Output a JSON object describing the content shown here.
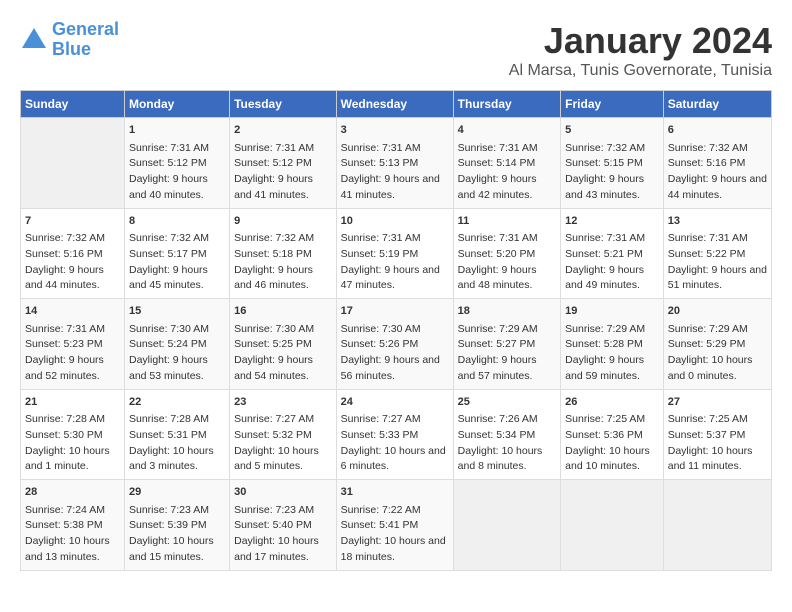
{
  "header": {
    "logo_line1": "General",
    "logo_line2": "Blue",
    "title": "January 2024",
    "subtitle": "Al Marsa, Tunis Governorate, Tunisia"
  },
  "calendar": {
    "days_of_week": [
      "Sunday",
      "Monday",
      "Tuesday",
      "Wednesday",
      "Thursday",
      "Friday",
      "Saturday"
    ],
    "weeks": [
      [
        {
          "day": "",
          "sunrise": "",
          "sunset": "",
          "daylight": ""
        },
        {
          "day": "1",
          "sunrise": "Sunrise: 7:31 AM",
          "sunset": "Sunset: 5:12 PM",
          "daylight": "Daylight: 9 hours and 40 minutes."
        },
        {
          "day": "2",
          "sunrise": "Sunrise: 7:31 AM",
          "sunset": "Sunset: 5:12 PM",
          "daylight": "Daylight: 9 hours and 41 minutes."
        },
        {
          "day": "3",
          "sunrise": "Sunrise: 7:31 AM",
          "sunset": "Sunset: 5:13 PM",
          "daylight": "Daylight: 9 hours and 41 minutes."
        },
        {
          "day": "4",
          "sunrise": "Sunrise: 7:31 AM",
          "sunset": "Sunset: 5:14 PM",
          "daylight": "Daylight: 9 hours and 42 minutes."
        },
        {
          "day": "5",
          "sunrise": "Sunrise: 7:32 AM",
          "sunset": "Sunset: 5:15 PM",
          "daylight": "Daylight: 9 hours and 43 minutes."
        },
        {
          "day": "6",
          "sunrise": "Sunrise: 7:32 AM",
          "sunset": "Sunset: 5:16 PM",
          "daylight": "Daylight: 9 hours and 44 minutes."
        }
      ],
      [
        {
          "day": "7",
          "sunrise": "Sunrise: 7:32 AM",
          "sunset": "Sunset: 5:16 PM",
          "daylight": "Daylight: 9 hours and 44 minutes."
        },
        {
          "day": "8",
          "sunrise": "Sunrise: 7:32 AM",
          "sunset": "Sunset: 5:17 PM",
          "daylight": "Daylight: 9 hours and 45 minutes."
        },
        {
          "day": "9",
          "sunrise": "Sunrise: 7:32 AM",
          "sunset": "Sunset: 5:18 PM",
          "daylight": "Daylight: 9 hours and 46 minutes."
        },
        {
          "day": "10",
          "sunrise": "Sunrise: 7:31 AM",
          "sunset": "Sunset: 5:19 PM",
          "daylight": "Daylight: 9 hours and 47 minutes."
        },
        {
          "day": "11",
          "sunrise": "Sunrise: 7:31 AM",
          "sunset": "Sunset: 5:20 PM",
          "daylight": "Daylight: 9 hours and 48 minutes."
        },
        {
          "day": "12",
          "sunrise": "Sunrise: 7:31 AM",
          "sunset": "Sunset: 5:21 PM",
          "daylight": "Daylight: 9 hours and 49 minutes."
        },
        {
          "day": "13",
          "sunrise": "Sunrise: 7:31 AM",
          "sunset": "Sunset: 5:22 PM",
          "daylight": "Daylight: 9 hours and 51 minutes."
        }
      ],
      [
        {
          "day": "14",
          "sunrise": "Sunrise: 7:31 AM",
          "sunset": "Sunset: 5:23 PM",
          "daylight": "Daylight: 9 hours and 52 minutes."
        },
        {
          "day": "15",
          "sunrise": "Sunrise: 7:30 AM",
          "sunset": "Sunset: 5:24 PM",
          "daylight": "Daylight: 9 hours and 53 minutes."
        },
        {
          "day": "16",
          "sunrise": "Sunrise: 7:30 AM",
          "sunset": "Sunset: 5:25 PM",
          "daylight": "Daylight: 9 hours and 54 minutes."
        },
        {
          "day": "17",
          "sunrise": "Sunrise: 7:30 AM",
          "sunset": "Sunset: 5:26 PM",
          "daylight": "Daylight: 9 hours and 56 minutes."
        },
        {
          "day": "18",
          "sunrise": "Sunrise: 7:29 AM",
          "sunset": "Sunset: 5:27 PM",
          "daylight": "Daylight: 9 hours and 57 minutes."
        },
        {
          "day": "19",
          "sunrise": "Sunrise: 7:29 AM",
          "sunset": "Sunset: 5:28 PM",
          "daylight": "Daylight: 9 hours and 59 minutes."
        },
        {
          "day": "20",
          "sunrise": "Sunrise: 7:29 AM",
          "sunset": "Sunset: 5:29 PM",
          "daylight": "Daylight: 10 hours and 0 minutes."
        }
      ],
      [
        {
          "day": "21",
          "sunrise": "Sunrise: 7:28 AM",
          "sunset": "Sunset: 5:30 PM",
          "daylight": "Daylight: 10 hours and 1 minute."
        },
        {
          "day": "22",
          "sunrise": "Sunrise: 7:28 AM",
          "sunset": "Sunset: 5:31 PM",
          "daylight": "Daylight: 10 hours and 3 minutes."
        },
        {
          "day": "23",
          "sunrise": "Sunrise: 7:27 AM",
          "sunset": "Sunset: 5:32 PM",
          "daylight": "Daylight: 10 hours and 5 minutes."
        },
        {
          "day": "24",
          "sunrise": "Sunrise: 7:27 AM",
          "sunset": "Sunset: 5:33 PM",
          "daylight": "Daylight: 10 hours and 6 minutes."
        },
        {
          "day": "25",
          "sunrise": "Sunrise: 7:26 AM",
          "sunset": "Sunset: 5:34 PM",
          "daylight": "Daylight: 10 hours and 8 minutes."
        },
        {
          "day": "26",
          "sunrise": "Sunrise: 7:25 AM",
          "sunset": "Sunset: 5:36 PM",
          "daylight": "Daylight: 10 hours and 10 minutes."
        },
        {
          "day": "27",
          "sunrise": "Sunrise: 7:25 AM",
          "sunset": "Sunset: 5:37 PM",
          "daylight": "Daylight: 10 hours and 11 minutes."
        }
      ],
      [
        {
          "day": "28",
          "sunrise": "Sunrise: 7:24 AM",
          "sunset": "Sunset: 5:38 PM",
          "daylight": "Daylight: 10 hours and 13 minutes."
        },
        {
          "day": "29",
          "sunrise": "Sunrise: 7:23 AM",
          "sunset": "Sunset: 5:39 PM",
          "daylight": "Daylight: 10 hours and 15 minutes."
        },
        {
          "day": "30",
          "sunrise": "Sunrise: 7:23 AM",
          "sunset": "Sunset: 5:40 PM",
          "daylight": "Daylight: 10 hours and 17 minutes."
        },
        {
          "day": "31",
          "sunrise": "Sunrise: 7:22 AM",
          "sunset": "Sunset: 5:41 PM",
          "daylight": "Daylight: 10 hours and 18 minutes."
        },
        {
          "day": "",
          "sunrise": "",
          "sunset": "",
          "daylight": ""
        },
        {
          "day": "",
          "sunrise": "",
          "sunset": "",
          "daylight": ""
        },
        {
          "day": "",
          "sunrise": "",
          "sunset": "",
          "daylight": ""
        }
      ]
    ]
  }
}
